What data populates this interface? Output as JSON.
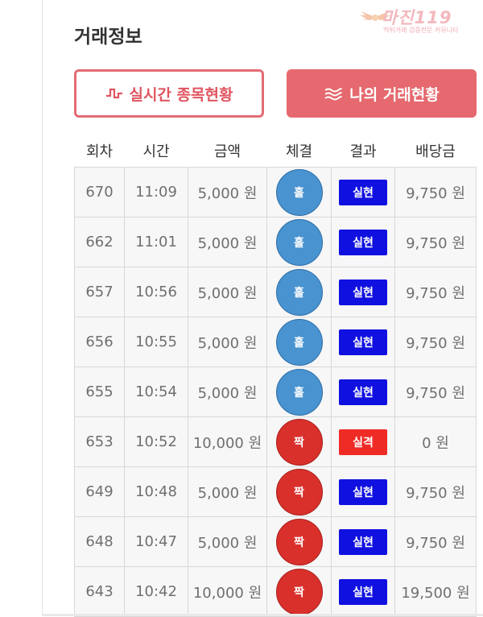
{
  "brand": {
    "name": "마진",
    "suffix": "119",
    "tagline": "먹튀거래 검증전문 커뮤니티",
    "color": "#f3b8bd"
  },
  "page": {
    "title": "거래정보"
  },
  "buttons": {
    "live": {
      "label": "실시간 종목현황",
      "icon": "pulse-icon"
    },
    "mine": {
      "label": "나의 거래현황",
      "icon": "wave-icon"
    }
  },
  "colors": {
    "accent": "#e5696e",
    "odd": "#4893d0",
    "even": "#d9302c",
    "win": "#1010e0",
    "lose": "#ef2b25"
  },
  "table": {
    "headers": [
      "회차",
      "시간",
      "금액",
      "체결",
      "결과",
      "배당금"
    ],
    "rows": [
      {
        "round": "670",
        "time": "11:09",
        "amount": "5,000 원",
        "pick": "홀",
        "pick_type": "odd",
        "result": "실현",
        "result_type": "win",
        "payout": "9,750 원"
      },
      {
        "round": "662",
        "time": "11:01",
        "amount": "5,000 원",
        "pick": "홀",
        "pick_type": "odd",
        "result": "실현",
        "result_type": "win",
        "payout": "9,750 원"
      },
      {
        "round": "657",
        "time": "10:56",
        "amount": "5,000 원",
        "pick": "홀",
        "pick_type": "odd",
        "result": "실현",
        "result_type": "win",
        "payout": "9,750 원"
      },
      {
        "round": "656",
        "time": "10:55",
        "amount": "5,000 원",
        "pick": "홀",
        "pick_type": "odd",
        "result": "실현",
        "result_type": "win",
        "payout": "9,750 원"
      },
      {
        "round": "655",
        "time": "10:54",
        "amount": "5,000 원",
        "pick": "홀",
        "pick_type": "odd",
        "result": "실현",
        "result_type": "win",
        "payout": "9,750 원"
      },
      {
        "round": "653",
        "time": "10:52",
        "amount": "10,000 원",
        "pick": "짝",
        "pick_type": "even",
        "result": "실격",
        "result_type": "lose",
        "payout": "0 원"
      },
      {
        "round": "649",
        "time": "10:48",
        "amount": "5,000 원",
        "pick": "짝",
        "pick_type": "even",
        "result": "실현",
        "result_type": "win",
        "payout": "9,750 원"
      },
      {
        "round": "648",
        "time": "10:47",
        "amount": "5,000 원",
        "pick": "짝",
        "pick_type": "even",
        "result": "실현",
        "result_type": "win",
        "payout": "9,750 원"
      },
      {
        "round": "643",
        "time": "10:42",
        "amount": "10,000 원",
        "pick": "짝",
        "pick_type": "even",
        "result": "실현",
        "result_type": "win",
        "payout": "19,500 원"
      }
    ]
  }
}
